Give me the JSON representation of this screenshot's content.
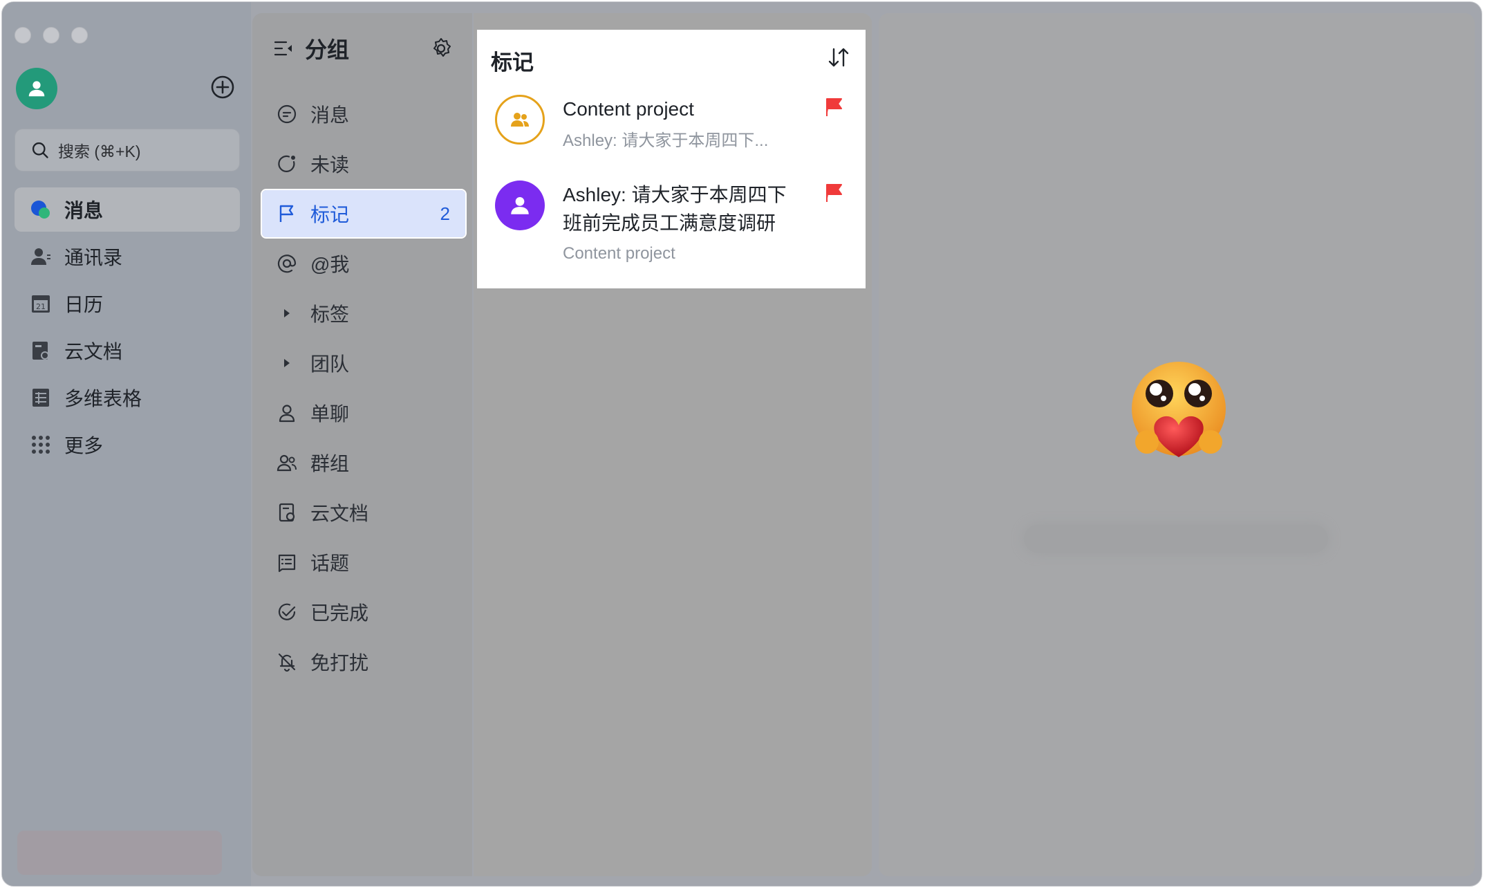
{
  "sidebar": {
    "search_placeholder": "搜索 (⌘+K)",
    "items": [
      {
        "label": "消息",
        "icon": "message-bubbles-icon",
        "active": true
      },
      {
        "label": "通讯录",
        "icon": "contacts-icon"
      },
      {
        "label": "日历",
        "icon": "calendar-icon",
        "day": "21"
      },
      {
        "label": "云文档",
        "icon": "cloud-doc-icon"
      },
      {
        "label": "多维表格",
        "icon": "table-icon"
      },
      {
        "label": "更多",
        "icon": "grid-dots-icon"
      }
    ]
  },
  "groups": {
    "title": "分组",
    "items": [
      {
        "label": "消息",
        "icon": "chat-icon"
      },
      {
        "label": "未读",
        "icon": "unread-icon"
      },
      {
        "label": "标记",
        "icon": "flag-outline-icon",
        "active": true,
        "count": "2"
      },
      {
        "label": "@我",
        "icon": "at-icon"
      },
      {
        "label": "标签",
        "icon": "triangle-right-icon"
      },
      {
        "label": "团队",
        "icon": "triangle-right-icon"
      },
      {
        "label": "单聊",
        "icon": "person-icon"
      },
      {
        "label": "群组",
        "icon": "group-icon"
      },
      {
        "label": "云文档",
        "icon": "doc-icon"
      },
      {
        "label": "话题",
        "icon": "topic-icon"
      },
      {
        "label": "已完成",
        "icon": "check-circle-icon"
      },
      {
        "label": "免打扰",
        "icon": "bell-off-icon"
      }
    ]
  },
  "list": {
    "title": "标记",
    "rows": [
      {
        "title": "Content project",
        "subtitle": "Ashley: 请大家于本周四下...",
        "avatar": "group-avatar-icon",
        "flag_color": "#f03a3a"
      },
      {
        "title": "Ashley: 请大家于本周四下班前完成员工满意度调研",
        "subtitle": "Content project",
        "avatar": "person-avatar-icon",
        "flag_color": "#f03a3a"
      }
    ]
  },
  "colors": {
    "accent_blue": "#1f5bd9",
    "active_bg": "#dae3fb",
    "avatar_green": "#239a7a",
    "avatar_purple": "#7b2cf0",
    "avatar_ring_gold": "#e5a21b"
  }
}
